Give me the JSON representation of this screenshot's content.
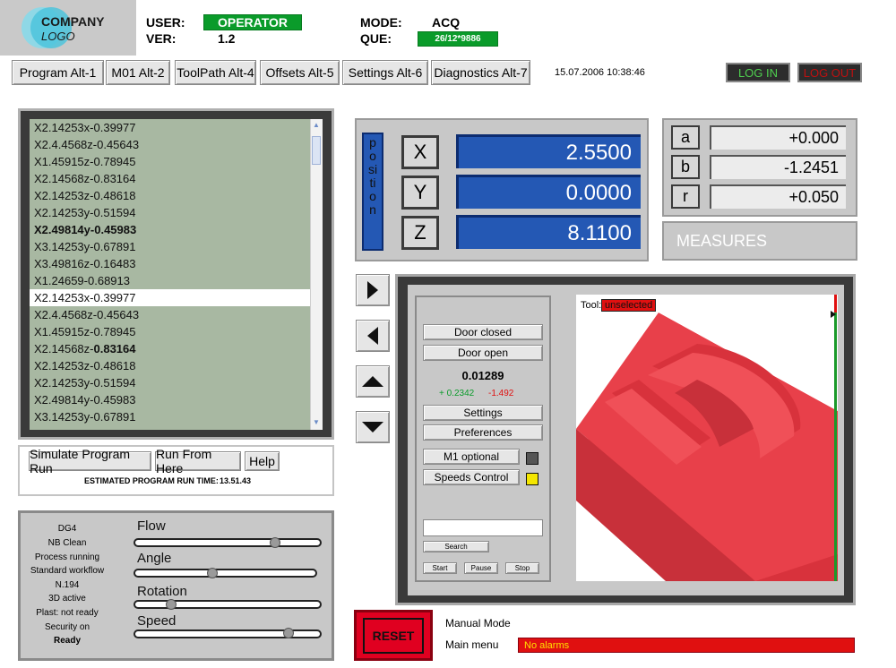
{
  "header": {
    "logo_line1": "COMPANY",
    "logo_line2": "LOGO",
    "user_label": "USER:",
    "user_value": "OPERATOR",
    "ver_label": "VER:",
    "ver_value": "1.2",
    "mode_label": "MODE:",
    "mode_value": "ACQ",
    "que_label": "QUE:",
    "que_value": "26/12*9886"
  },
  "tabs": [
    {
      "label": "Program Alt-1"
    },
    {
      "label": "M01 Alt-2"
    },
    {
      "label": "ToolPath Alt-4"
    },
    {
      "label": "Offsets Alt-5"
    },
    {
      "label": "Settings Alt-6"
    },
    {
      "label": "Diagnostics Alt-7"
    }
  ],
  "datetime": "15.07.2006 10:38:46",
  "login_label": "LOG IN",
  "logout_label": "LOG OUT",
  "program": {
    "lines": [
      "X2.14253x-0.39977",
      "X2.4.4568z-0.45643",
      "X1.45915z-0.78945",
      "X2.14568z-0.83164",
      "X2.14253z-0.48618",
      "X2.14253y-0.51594",
      "X2.49814y-0.45983",
      "X3.14253y-0.67891",
      "X3.49816z-0.16483",
      "X1.24659-0.68913",
      "X2.14253x-0.39977",
      "X2.4.4568z-0.45643",
      "X1.45915z-0.78945",
      "X2.14568z-0.83164",
      "X2.14253z-0.48618",
      "X2.14253y-0.51594",
      "X2.49814y-0.45983",
      "X3.14253y-0.67891"
    ],
    "line14_prefix": "X2.14568z-",
    "line14_bold": "0.83164",
    "selected_index": 10,
    "bold_index": 6,
    "simulate_label": "Simulate Program Run",
    "run_from_label": "Run From Here",
    "help_label": "Help",
    "est_label": "ESTIMATED PROGRAM RUN TIME:",
    "est_value": "13.51.43"
  },
  "status": {
    "lines": [
      "DG4",
      "NB Clean",
      "Process running",
      "Standard workflow",
      "N.194",
      "3D active",
      "Plast: not ready",
      "Security on",
      "Ready"
    ]
  },
  "sliders": [
    {
      "label": "Flow",
      "value": 0.78
    },
    {
      "label": "Angle",
      "value": 0.42
    },
    {
      "label": "Rotation",
      "value": 0.17
    },
    {
      "label": "Speed",
      "value": 0.86
    }
  ],
  "position": {
    "vertical_label": "position",
    "axes": [
      {
        "name": "X",
        "value": "2.5500"
      },
      {
        "name": "Y",
        "value": "0.0000"
      },
      {
        "name": "Z",
        "value": "8.1100"
      }
    ]
  },
  "measures": {
    "rows": [
      {
        "name": "a",
        "value": "+0.000"
      },
      {
        "name": "b",
        "value": "-1.2451"
      },
      {
        "name": "r",
        "value": "+0.050"
      }
    ],
    "button_label": "MEASURES"
  },
  "arrows": [
    "arrow-right-icon",
    "arrow-left-icon",
    "arrow-up-icon",
    "arrow-down-icon"
  ],
  "controls": {
    "door_closed": "Door closed",
    "door_open": "Door open",
    "value_main": "0.01289",
    "value_plus": "+ 0.2342",
    "value_minus": "-1.492",
    "settings": "Settings",
    "preferences": "Preferences",
    "m1_optional": "M1 optional",
    "speeds_control": "Speeds Control",
    "search_placeholder": "",
    "search": "Search",
    "start": "Start",
    "pause": "Pause",
    "stop": "Stop"
  },
  "viewer": {
    "tool_label": "Tool:",
    "tool_value": "unselected"
  },
  "footer": {
    "reset": "RESET",
    "manual_mode": "Manual Mode",
    "main_menu": "Main menu",
    "alarm": "No alarms"
  },
  "colors": {
    "panel_gray": "#c8c8c8",
    "value_blue": "#2458b4",
    "status_green": "#0a9b2a",
    "alarm_red": "#e01010",
    "model_red": "#e8404a"
  }
}
